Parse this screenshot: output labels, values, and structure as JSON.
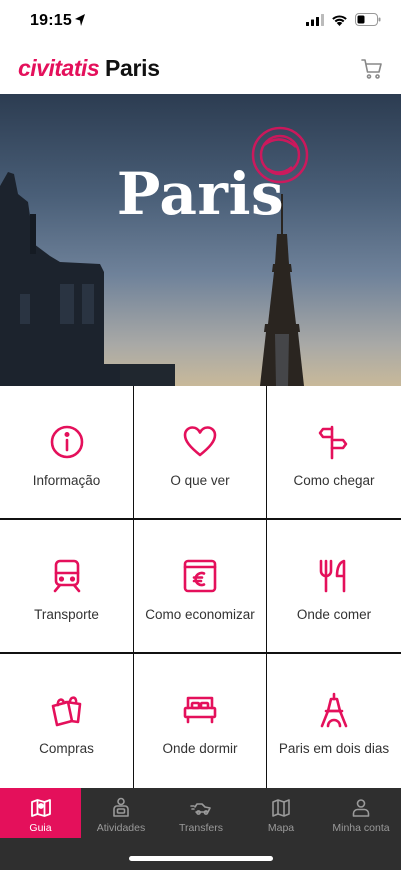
{
  "status_bar": {
    "time": "19:15"
  },
  "header": {
    "brand": "civitatis",
    "city": "Paris"
  },
  "hero": {
    "title": "Paris"
  },
  "tiles": [
    {
      "label": "Informação",
      "icon": "info-icon"
    },
    {
      "label": "O que ver",
      "icon": "heart-icon"
    },
    {
      "label": "Como chegar",
      "icon": "signpost-icon"
    },
    {
      "label": "Transporte",
      "icon": "train-icon"
    },
    {
      "label": "Como economizar",
      "icon": "euro-wallet-icon"
    },
    {
      "label": "Onde comer",
      "icon": "cutlery-icon"
    },
    {
      "label": "Compras",
      "icon": "shopping-bags-icon"
    },
    {
      "label": "Onde dormir",
      "icon": "bed-icon"
    },
    {
      "label": "Paris em dois dias",
      "icon": "eiffel-tower-icon"
    }
  ],
  "nav": [
    {
      "label": "Guia",
      "icon": "map-icon",
      "active": true
    },
    {
      "label": "Atividades",
      "icon": "activities-icon",
      "active": false
    },
    {
      "label": "Transfers",
      "icon": "car-transfer-icon",
      "active": false
    },
    {
      "label": "Mapa",
      "icon": "map-fold-icon",
      "active": false
    },
    {
      "label": "Minha conta",
      "icon": "user-icon",
      "active": false
    }
  ],
  "colors": {
    "brand": "#e4105b",
    "nav_bg": "#2f2f2f",
    "nav_label": "#9a9a9a"
  }
}
